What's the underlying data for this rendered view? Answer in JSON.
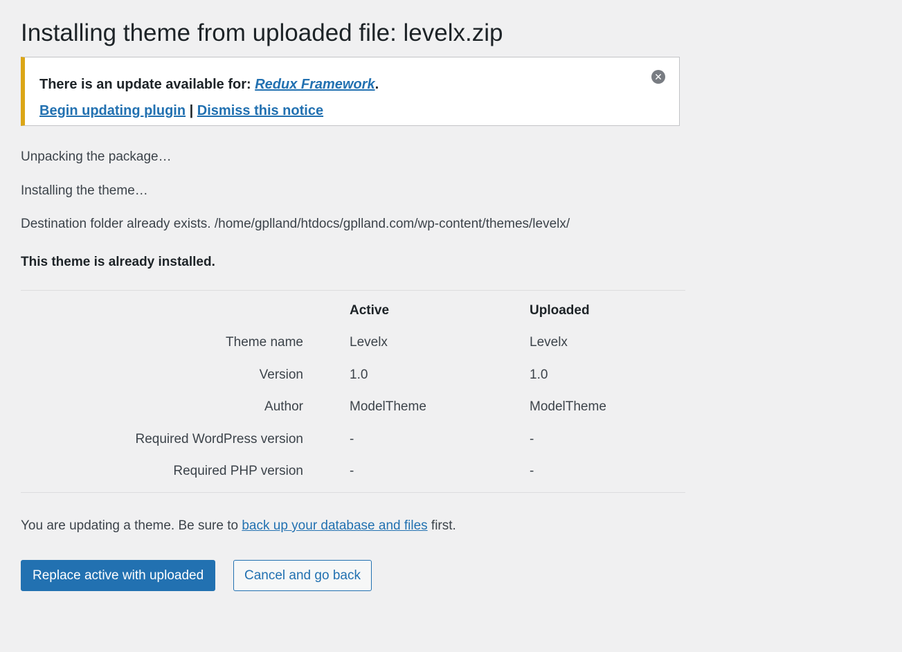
{
  "page": {
    "title": "Installing theme from uploaded file: levelx.zip"
  },
  "notice": {
    "prefix": "There is an update available for: ",
    "plugin_name": "Redux Framework",
    "suffix": ".",
    "begin_update": "Begin updating plugin",
    "separator": " | ",
    "dismiss_link": "Dismiss this notice",
    "dismiss_icon": "close-circle-icon",
    "border_color": "#dba617"
  },
  "messages": {
    "unpacking": "Unpacking the package…",
    "installing": "Installing the theme…",
    "destination": "Destination folder already exists. /home/gplland/htdocs/gplland.com/wp-content/themes/levelx/",
    "already_installed": "This theme is already installed."
  },
  "comparison": {
    "headers": {
      "active": "Active",
      "uploaded": "Uploaded"
    },
    "rows": [
      {
        "label": "Theme name",
        "active": "Levelx",
        "uploaded": "Levelx"
      },
      {
        "label": "Version",
        "active": "1.0",
        "uploaded": "1.0"
      },
      {
        "label": "Author",
        "active": "ModelTheme",
        "uploaded": "ModelTheme"
      },
      {
        "label": "Required WordPress version",
        "active": "-",
        "uploaded": "-"
      },
      {
        "label": "Required PHP version",
        "active": "-",
        "uploaded": "-"
      }
    ]
  },
  "footer": {
    "prefix": "You are updating a theme. Be sure to ",
    "link": "back up your database and files",
    "suffix": " first."
  },
  "actions": {
    "replace": "Replace active with uploaded",
    "cancel": "Cancel and go back"
  },
  "colors": {
    "primary": "#2271b1",
    "background": "#f0f0f1"
  }
}
